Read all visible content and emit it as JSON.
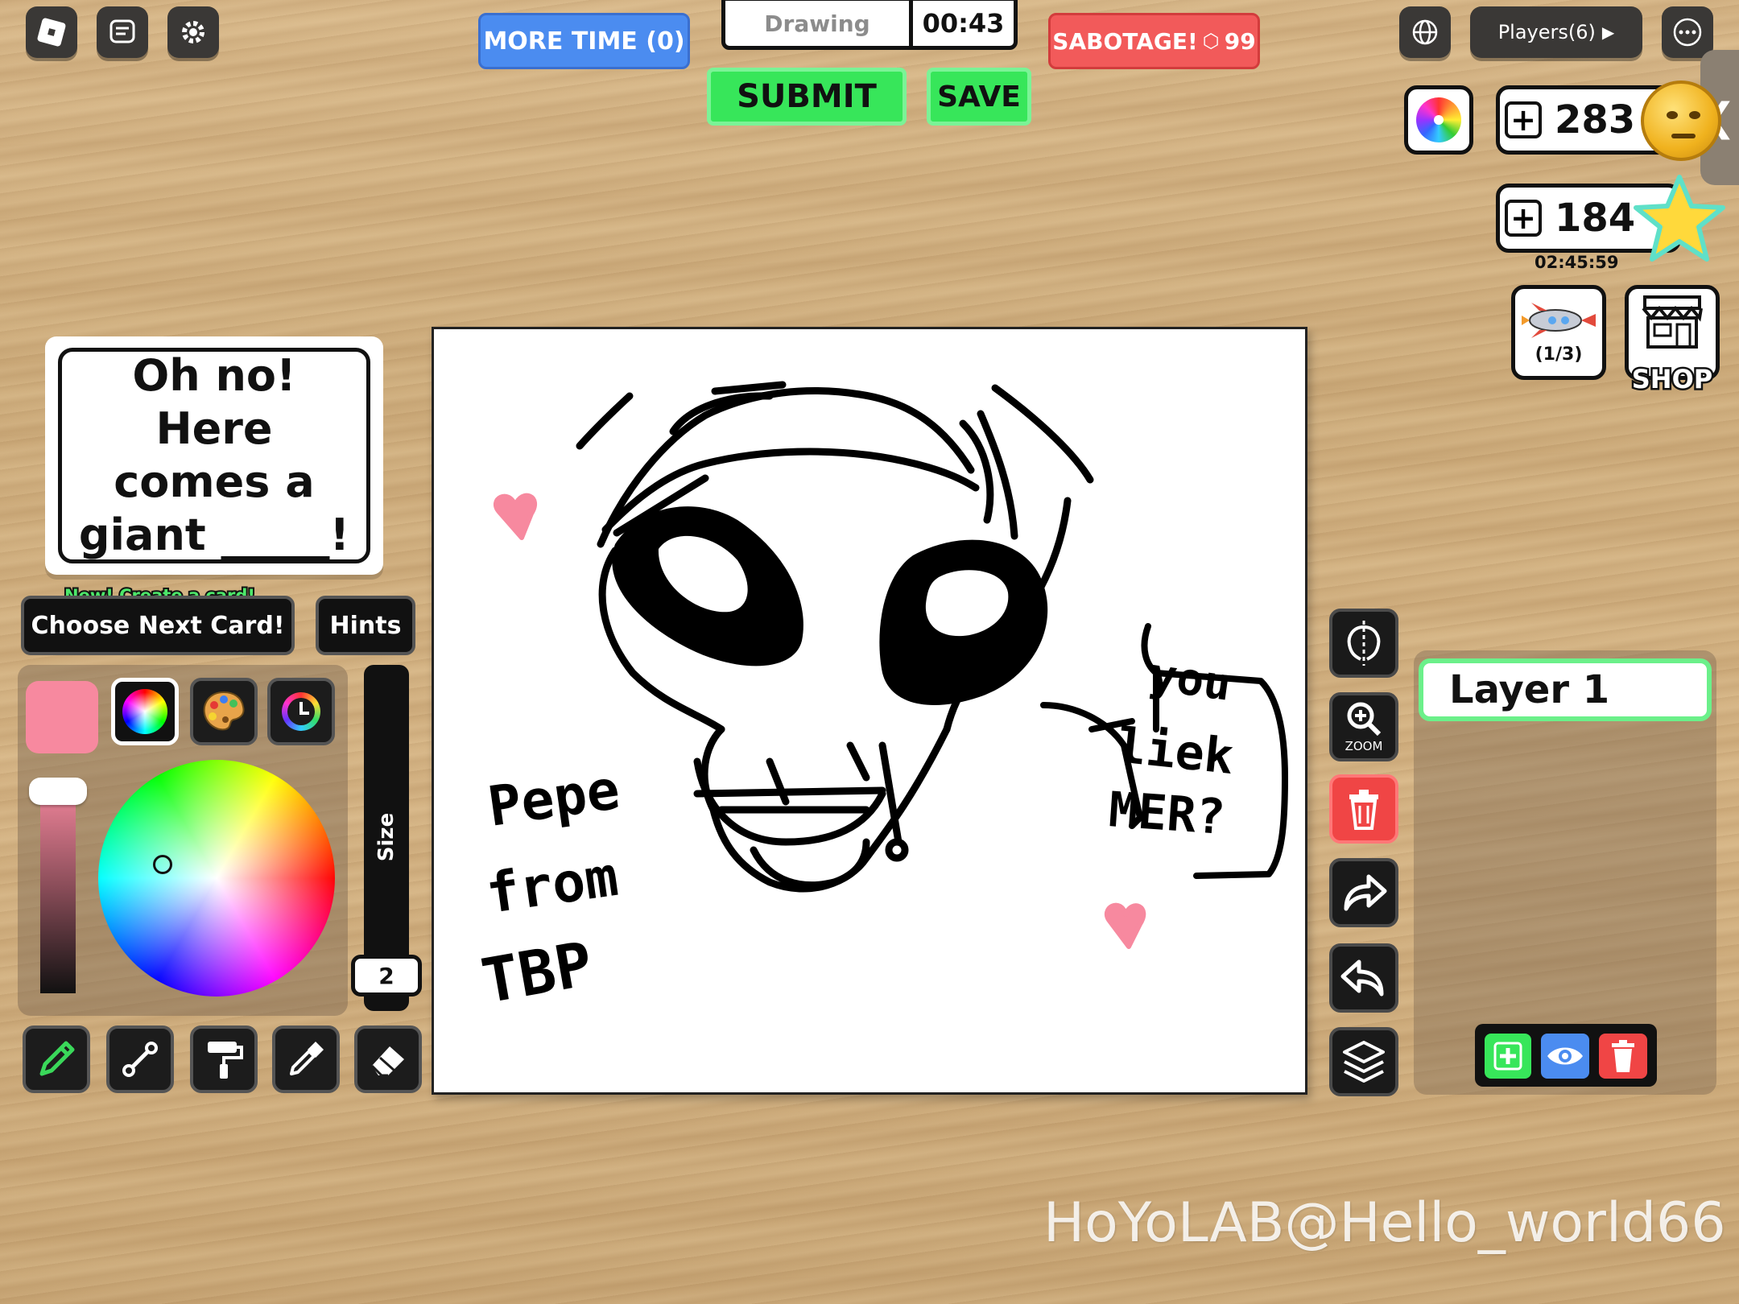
{
  "topbar": {
    "more_time_label": "MORE TIME (0)",
    "mode_label": "Drawing",
    "timer": "00:43",
    "sabotage_label": "SABOTAGE!",
    "sabotage_cost": "99",
    "submit_label": "SUBMIT",
    "save_label": "SAVE",
    "players_label": "Players(6)"
  },
  "currency": {
    "coins": "283",
    "stars": "184",
    "stars_timer": "02:45:59"
  },
  "shop": {
    "rocket_label": "(1/3)",
    "shop_label": "SHOP"
  },
  "prompt_card": {
    "text": "Oh no! Here comes a giant _____!",
    "new_badge": "New! Create a card!",
    "choose_next_label": "Choose Next Card!",
    "hints_label": "Hints"
  },
  "palette": {
    "current_color": "#f7899f",
    "size_label": "Size",
    "size_value": "2"
  },
  "layers": {
    "layer_name": "Layer 1"
  },
  "side_tools": {
    "zoom_label": "ZOOM"
  },
  "drawing_texts": {
    "line1": "Pepe",
    "line2": "from",
    "line3": "TBP",
    "speech1": "you",
    "speech2": "liek",
    "speech3": "MER?"
  },
  "watermark": "HoYoLAB@Hello_world66",
  "colors": {
    "accent_green": "#37e65a",
    "more_time_blue": "#4b8cf0",
    "sabotage_red": "#f25a5a",
    "delete_red": "#f04545"
  }
}
